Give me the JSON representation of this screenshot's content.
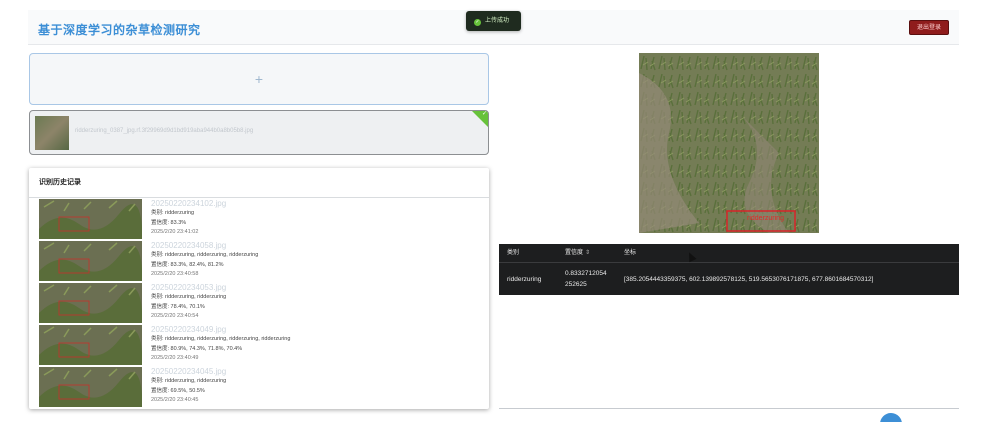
{
  "header": {
    "title": "基于深度学习的杂草检测研究",
    "logout_label": "退出登录"
  },
  "toast": {
    "message": "上传成功",
    "icon": "check-circle-icon"
  },
  "upload": {
    "plus": "+",
    "file_name": "ridderzuring_0387_jpg.rf.3f29969d9d1bd919aba944b0a8b05b8.jpg",
    "file_status_icon": "check-icon"
  },
  "history": {
    "title": "识别历史记录",
    "items": [
      {
        "name": "20250220234102.jpg",
        "classes": "类别: ridderzuring",
        "confidence": "置信度: 83.3%",
        "time": "2025/2/20 23:41:02"
      },
      {
        "name": "20250220234058.jpg",
        "classes": "类别: ridderzuring, ridderzuring, ridderzuring",
        "confidence": "置信度: 83.3%, 82.4%, 81.2%",
        "time": "2025/2/20 23:40:58"
      },
      {
        "name": "20250220234053.jpg",
        "classes": "类别: ridderzuring, ridderzuring",
        "confidence": "置信度: 78.4%, 70.1%",
        "time": "2025/2/20 23:40:54"
      },
      {
        "name": "20250220234049.jpg",
        "classes": "类别: ridderzuring, ridderzuring, ridderzuring, ridderzuring",
        "confidence": "置信度: 80.9%, 74.3%, 71.8%, 70.4%",
        "time": "2025/2/20 23:40:49"
      },
      {
        "name": "20250220234045.jpg",
        "classes": "类别: ridderzuring, ridderzuring",
        "confidence": "置信度: 69.5%, 50.5%",
        "time": "2025/2/20 23:40:45"
      }
    ]
  },
  "result": {
    "detection_label": "ridderzuring",
    "table": {
      "headers": [
        "类别",
        "置信度",
        "坐标"
      ],
      "sort_icon": "⇕",
      "rows": [
        {
          "class": "ridderzuring",
          "confidence_line1": "0.8332712054",
          "confidence_line2": "252625",
          "coords": "[385.2054443359375, 602.139892578125, 519.5653076171875, 677.8601684570312]"
        }
      ]
    }
  },
  "colors": {
    "accent": "#3d8fd6",
    "success": "#67c23a",
    "danger": "#8f1c1c",
    "table_bg": "#1d1e1f"
  }
}
